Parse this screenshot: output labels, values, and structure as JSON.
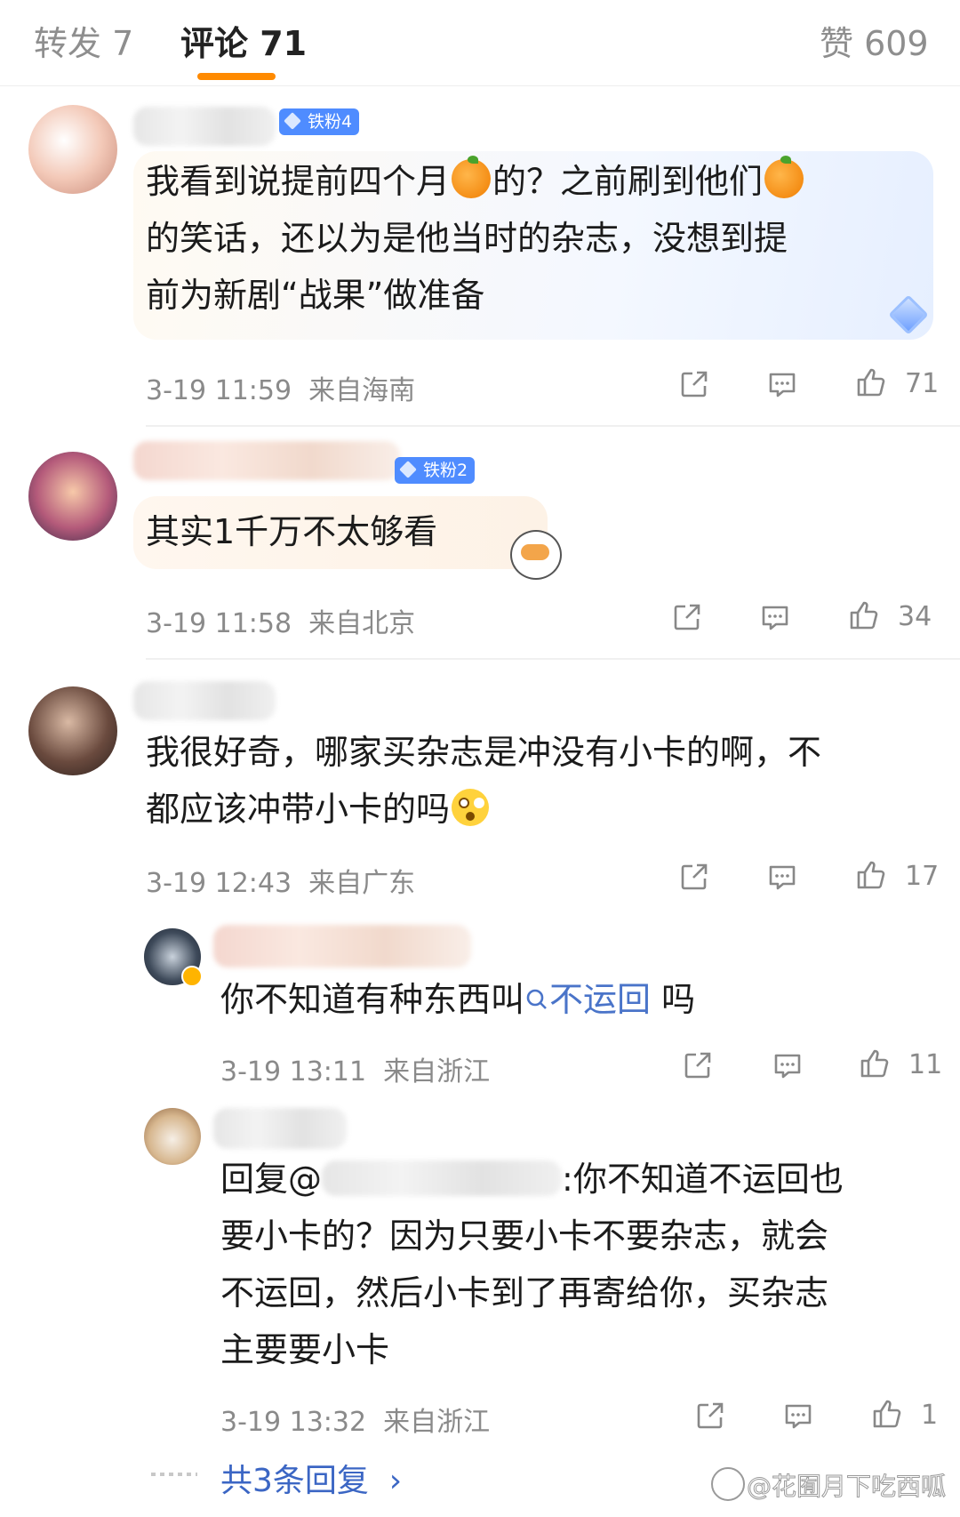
{
  "tabs": {
    "repost": "转发 7",
    "comments": "评论 71",
    "likes": "赞 609"
  },
  "comments": [
    {
      "badge": "铁粉4",
      "lines": [
        "我看到说提前四个月",
        "的？之前刷到他们",
        "的笑话，还以为是他当时的杂志，没想到提",
        "前为新剧“战果”做准备"
      ],
      "time": "3-19 11:59",
      "location": "来自海南",
      "likes": "71"
    },
    {
      "badge": "铁粉2",
      "lines": [
        "其实1千万不太够看"
      ],
      "time": "3-19 11:58",
      "location": "来自北京",
      "likes": "34"
    },
    {
      "lines": [
        "我很好奇，哪家买杂志是冲没有小卡的啊，不",
        "都应该冲带小卡的吗"
      ],
      "time": "3-19 12:43",
      "location": "来自广东",
      "likes": "17"
    }
  ],
  "replies": [
    {
      "text_before": "你不知道有种东西叫",
      "link": "不运回",
      "text_after": " 吗",
      "time": "3-19 13:11",
      "location": "来自浙江",
      "likes": "11"
    },
    {
      "prefix": "回复@",
      "lines": [
        ":你不知道不运回也",
        "要小卡的？因为只要小卡不要杂志，就会",
        "不运回，然后小卡到了再寄给你，买杂志",
        "主要要小卡"
      ],
      "time": "3-19 13:32",
      "location": "来自浙江",
      "likes": "1"
    }
  ],
  "more_replies": "共3条回复",
  "watermark": "@花囿月下吃西呱",
  "colors": {
    "accent": "#ff8a00",
    "link": "#4a74c9",
    "badge": "#4f8cff"
  }
}
